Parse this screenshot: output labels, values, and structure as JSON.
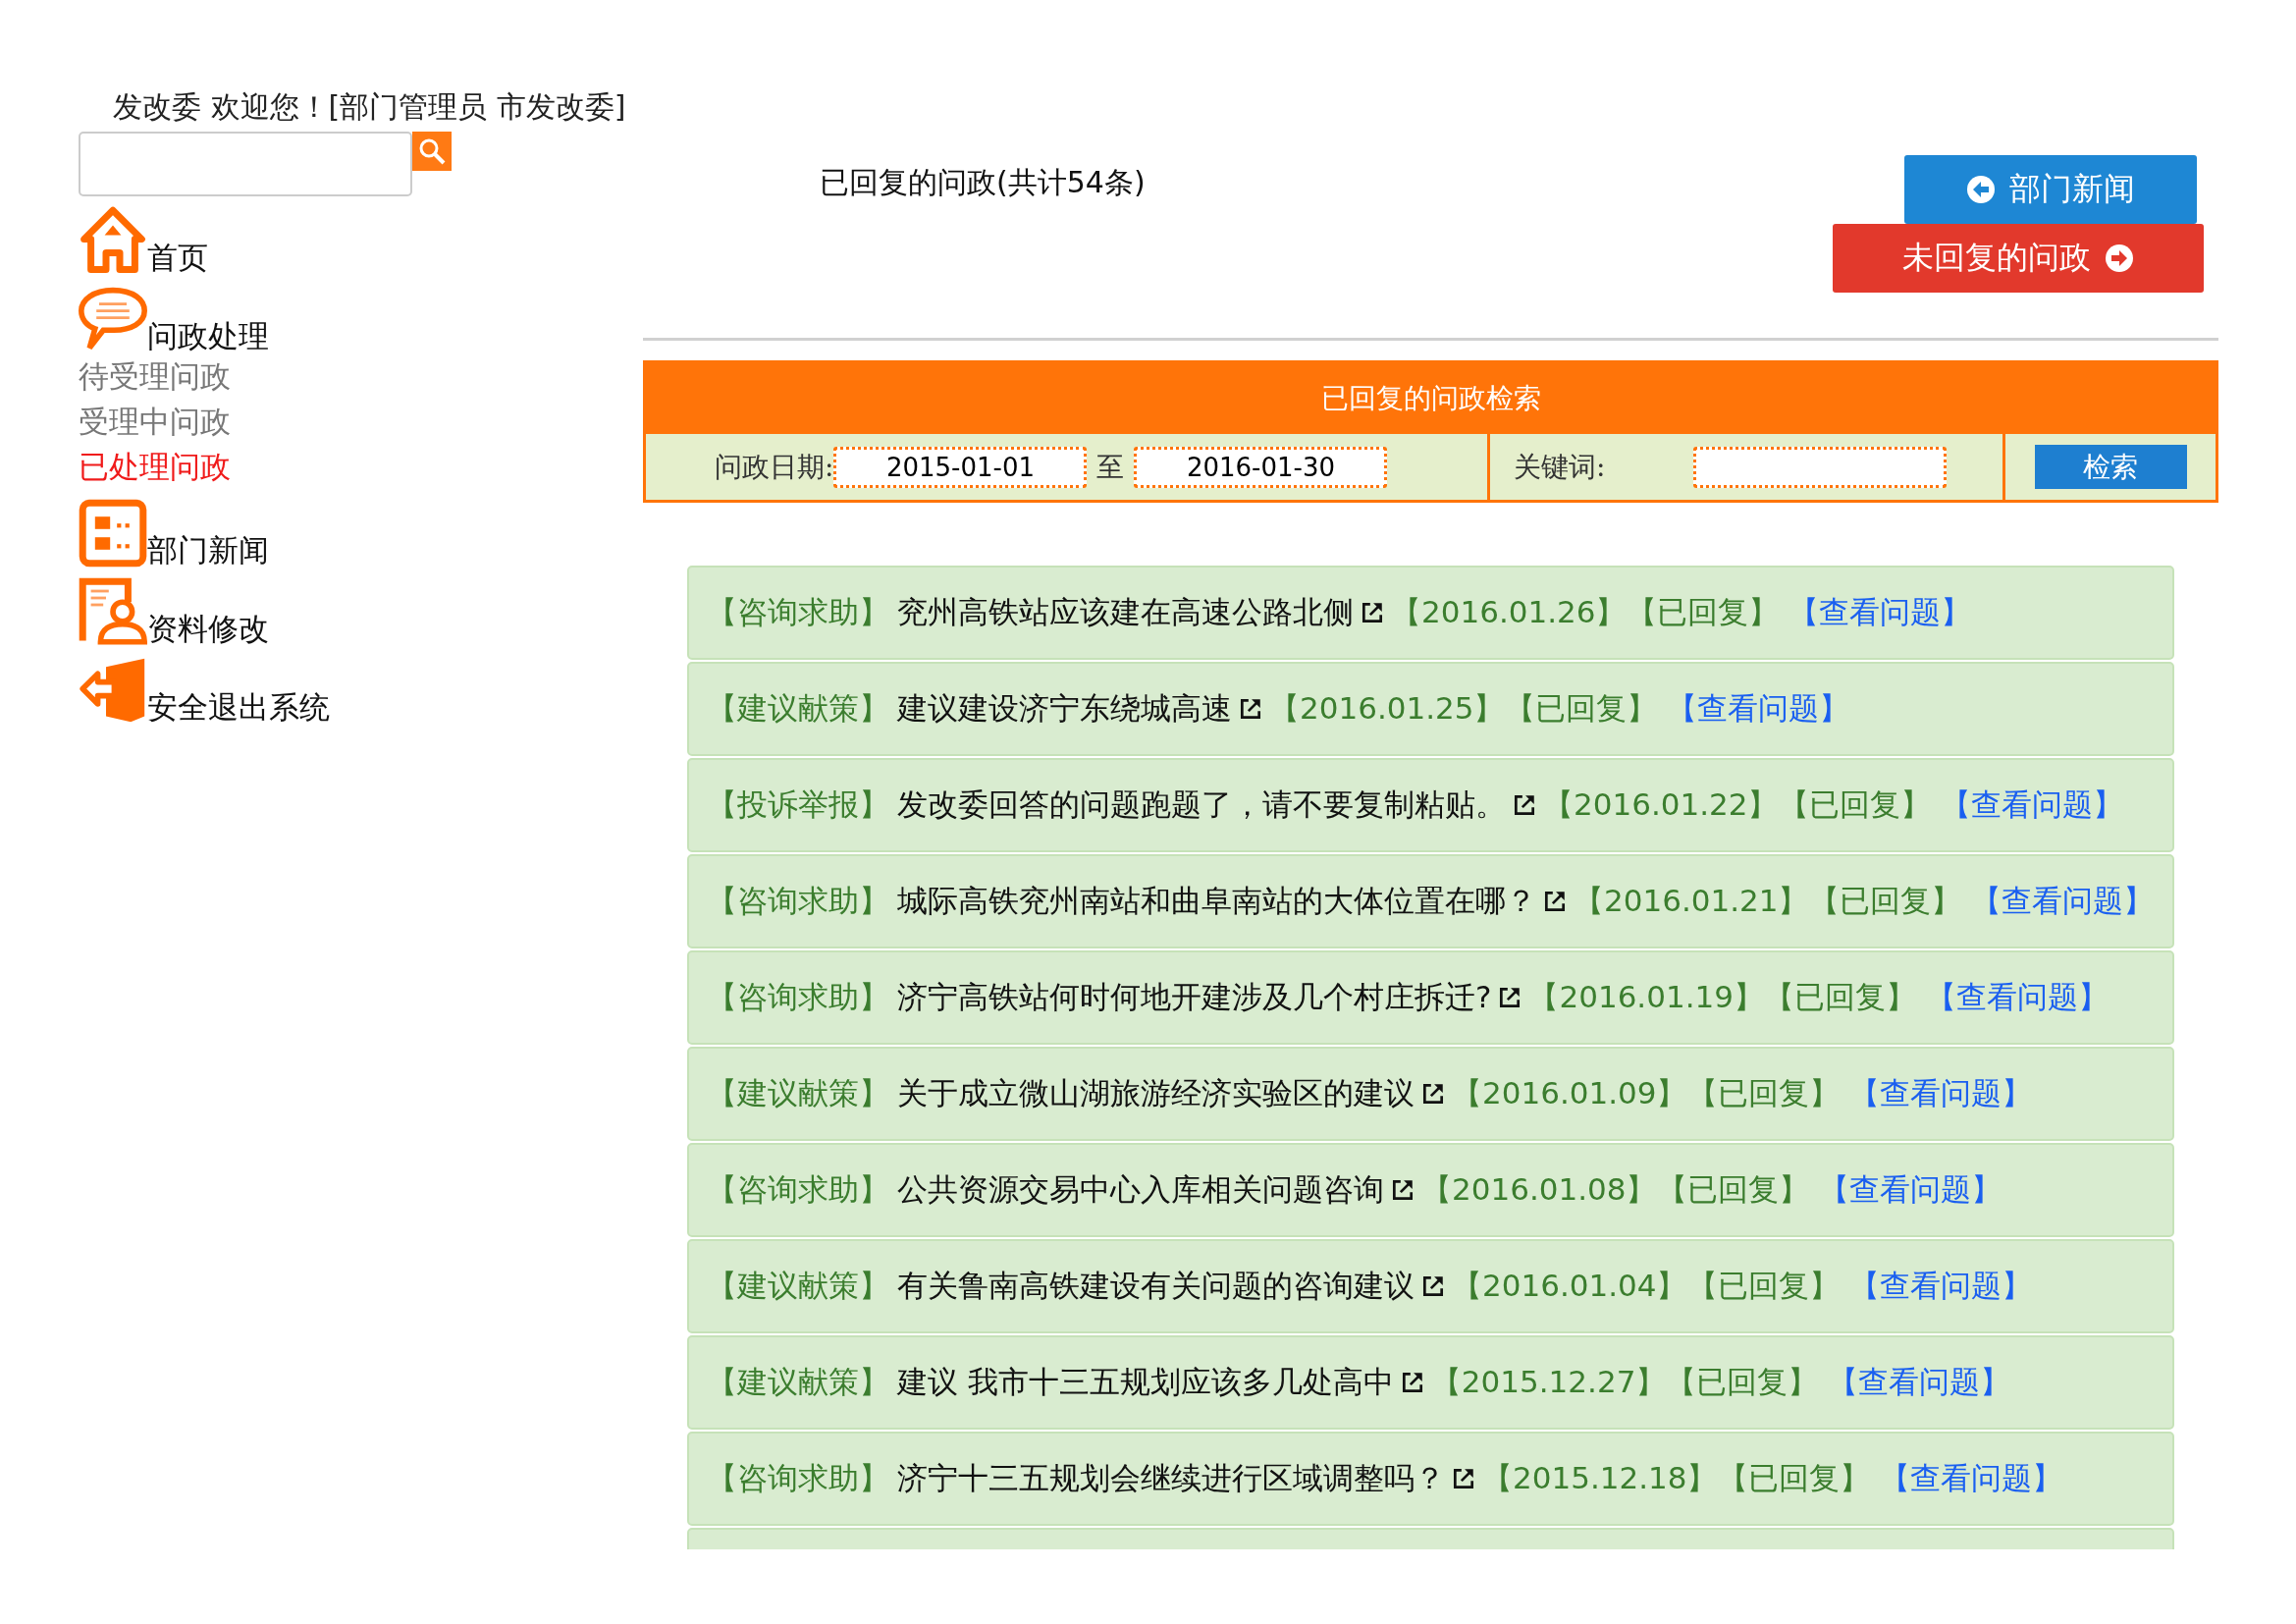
{
  "welcome": "发改委 欢迎您！[部门管理员 市发改委]",
  "sidebar": {
    "items": [
      {
        "kind": "home",
        "label": "首页"
      },
      {
        "kind": "chat",
        "label": "问政处理",
        "children": [
          {
            "label": "待受理问政",
            "selected": false
          },
          {
            "label": "受理中问政",
            "selected": false
          },
          {
            "label": "已处理问政",
            "selected": true
          }
        ]
      },
      {
        "kind": "news",
        "label": "部门新闻"
      },
      {
        "kind": "profile",
        "label": "资料修改"
      },
      {
        "kind": "exit",
        "label": "安全退出系统"
      }
    ]
  },
  "heading": "已回复的问政(共计54条)",
  "buttons": [
    {
      "kind": "back",
      "label": "部门新闻"
    },
    {
      "kind": "forward",
      "label": "未回复的问政"
    }
  ],
  "filter": {
    "title": "已回复的问政检索",
    "date_label": "问政日期:",
    "date_from": "2015-01-01",
    "separator": "至",
    "date_to": "2016-01-30",
    "keyword_label": "关键词:",
    "search_button": "检索"
  },
  "rows": [
    {
      "category": "【咨询求助】",
      "title": "兖州高铁站应该建在高速公路北侧",
      "date": "【2016.01.26】",
      "status": "【已回复】",
      "link": "【查看问题】"
    },
    {
      "category": "【建议献策】",
      "title": "建议建设济宁东绕城高速",
      "date": "【2016.01.25】",
      "status": "【已回复】",
      "link": "【查看问题】"
    },
    {
      "category": "【投诉举报】",
      "title": "发改委回答的问题跑题了，请不要复制粘贴。",
      "date": "【2016.01.22】",
      "status": "【已回复】",
      "link": "【查看问题】"
    },
    {
      "category": "【咨询求助】",
      "title": "城际高铁兖州南站和曲阜南站的大体位置在哪？",
      "date": "【2016.01.21】",
      "status": "【已回复】",
      "link": "【查看问题】"
    },
    {
      "category": "【咨询求助】",
      "title": "济宁高铁站何时何地开建涉及几个村庄拆迁?",
      "date": "【2016.01.19】",
      "status": "【已回复】",
      "link": "【查看问题】"
    },
    {
      "category": "【建议献策】",
      "title": "关于成立微山湖旅游经济实验区的建议",
      "date": "【2016.01.09】",
      "status": "【已回复】",
      "link": "【查看问题】"
    },
    {
      "category": "【咨询求助】",
      "title": "公共资源交易中心入库相关问题咨询",
      "date": "【2016.01.08】",
      "status": "【已回复】",
      "link": "【查看问题】"
    },
    {
      "category": "【建议献策】",
      "title": "有关鲁南高铁建设有关问题的咨询建议",
      "date": "【2016.01.04】",
      "status": "【已回复】",
      "link": "【查看问题】"
    },
    {
      "category": "【建议献策】",
      "title": "建议 我市十三五规划应该多几处高中",
      "date": "【2015.12.27】",
      "status": "【已回复】",
      "link": "【查看问题】"
    },
    {
      "category": "【咨询求助】",
      "title": "济宁十三五规划会继续进行区域调整吗？",
      "date": "【2015.12.18】",
      "status": "【已回复】",
      "link": "【查看问题】"
    }
  ]
}
